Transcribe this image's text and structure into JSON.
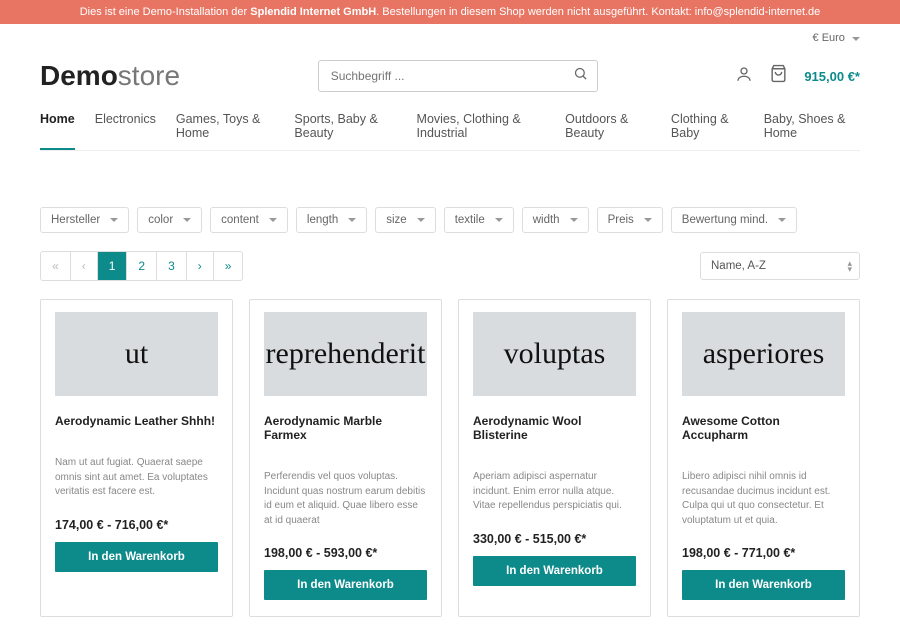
{
  "banner": {
    "prefix": "Dies ist eine Demo-Installation der ",
    "company": "Splendid Internet GmbH",
    "middle": ". Bestellungen in diesem Shop werden nicht ausgeführt. Kontakt: ",
    "email": "info@splendid-internet.de"
  },
  "currency_label": "€ Euro",
  "logo": {
    "bold": "Demo",
    "light": "store"
  },
  "search": {
    "placeholder": "Suchbegriff ..."
  },
  "cart_total": "915,00 €*",
  "nav": [
    {
      "label": "Home",
      "active": true
    },
    {
      "label": "Electronics"
    },
    {
      "label": "Games, Toys & Home"
    },
    {
      "label": "Sports, Baby & Beauty"
    },
    {
      "label": "Movies, Clothing & Industrial"
    },
    {
      "label": "Outdoors & Beauty"
    },
    {
      "label": "Clothing & Baby"
    },
    {
      "label": "Baby, Shoes & Home"
    }
  ],
  "filters": [
    "Hersteller",
    "color",
    "content",
    "length",
    "size",
    "textile",
    "width",
    "Preis",
    "Bewertung mind."
  ],
  "pager": [
    {
      "label": "«",
      "disabled": true
    },
    {
      "label": "‹",
      "disabled": true
    },
    {
      "label": "1",
      "current": true
    },
    {
      "label": "2"
    },
    {
      "label": "3"
    },
    {
      "label": "›"
    },
    {
      "label": "»"
    }
  ],
  "sort_selected": "Name, A-Z",
  "add_to_cart_label": "In den Warenkorb",
  "products": [
    {
      "img_text": "ut",
      "title": "Aerodynamic Leather Shhh!",
      "desc": "Nam ut aut fugiat. Quaerat saepe omnis sint aut amet. Ea voluptates veritatis est facere est.",
      "price": "174,00 € - 716,00 €*"
    },
    {
      "img_text": "reprehenderit",
      "title": "Aerodynamic Marble Farmex",
      "desc": "Perferendis vel quos voluptas. Incidunt quas nostrum earum debitis id eum et aliquid. Quae libero esse at id quaerat",
      "price": "198,00 € - 593,00 €*"
    },
    {
      "img_text": "voluptas",
      "title": "Aerodynamic Wool Blisterine",
      "desc": "Aperiam adipisci aspernatur incidunt. Enim error nulla atque. Vitae repellendus perspiciatis qui.",
      "price": "330,00 € - 515,00 €*"
    },
    {
      "img_text": "asperiores",
      "title": "Awesome Cotton Accupharm",
      "desc": "Libero adipisci nihil omnis id recusandae ducimus incidunt est. Culpa qui ut quo consectetur. Et voluptatum ut et quia.",
      "price": "198,00 € - 771,00 €*"
    }
  ]
}
